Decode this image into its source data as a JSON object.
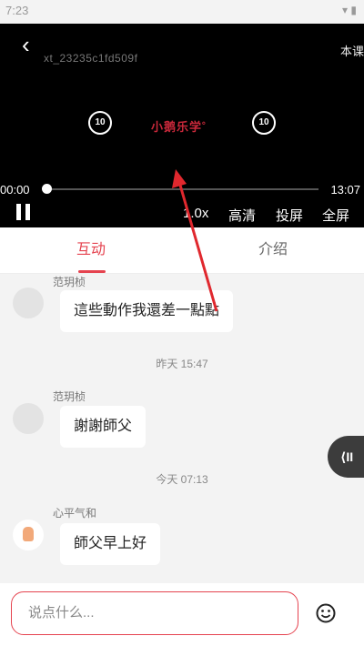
{
  "statusbar": {
    "time": "7:23",
    "icons": "▾ ▮"
  },
  "video": {
    "back_icon": "‹",
    "id_text": "xt_23235c1fd509f",
    "course_label": "本课",
    "rewind_label": "10",
    "forward_label": "10",
    "logo_text": "小鹅乐学˚",
    "current_time": "00:00",
    "total_time": "13:07",
    "progress": 0.01,
    "speed": "1.0x",
    "quality": "高清",
    "cast": "投屏",
    "fullscreen": "全屏"
  },
  "tabs": [
    {
      "label": "互动",
      "active": true
    },
    {
      "label": "介绍",
      "active": false
    }
  ],
  "messages": [
    {
      "sender": "范玥桢",
      "text": "這些動作我還差一點點"
    },
    {
      "stamp": "昨天 15:47"
    },
    {
      "sender": "范玥桢",
      "text": "謝謝師父"
    },
    {
      "stamp": "今天 07:13"
    },
    {
      "sender": "心平气和",
      "text": "師父早上好"
    }
  ],
  "side_tab": "⟨II",
  "input": {
    "placeholder": "说点什么..."
  },
  "colors": {
    "accent": "#e5434f",
    "annotation_arrow": "#e0282e"
  }
}
